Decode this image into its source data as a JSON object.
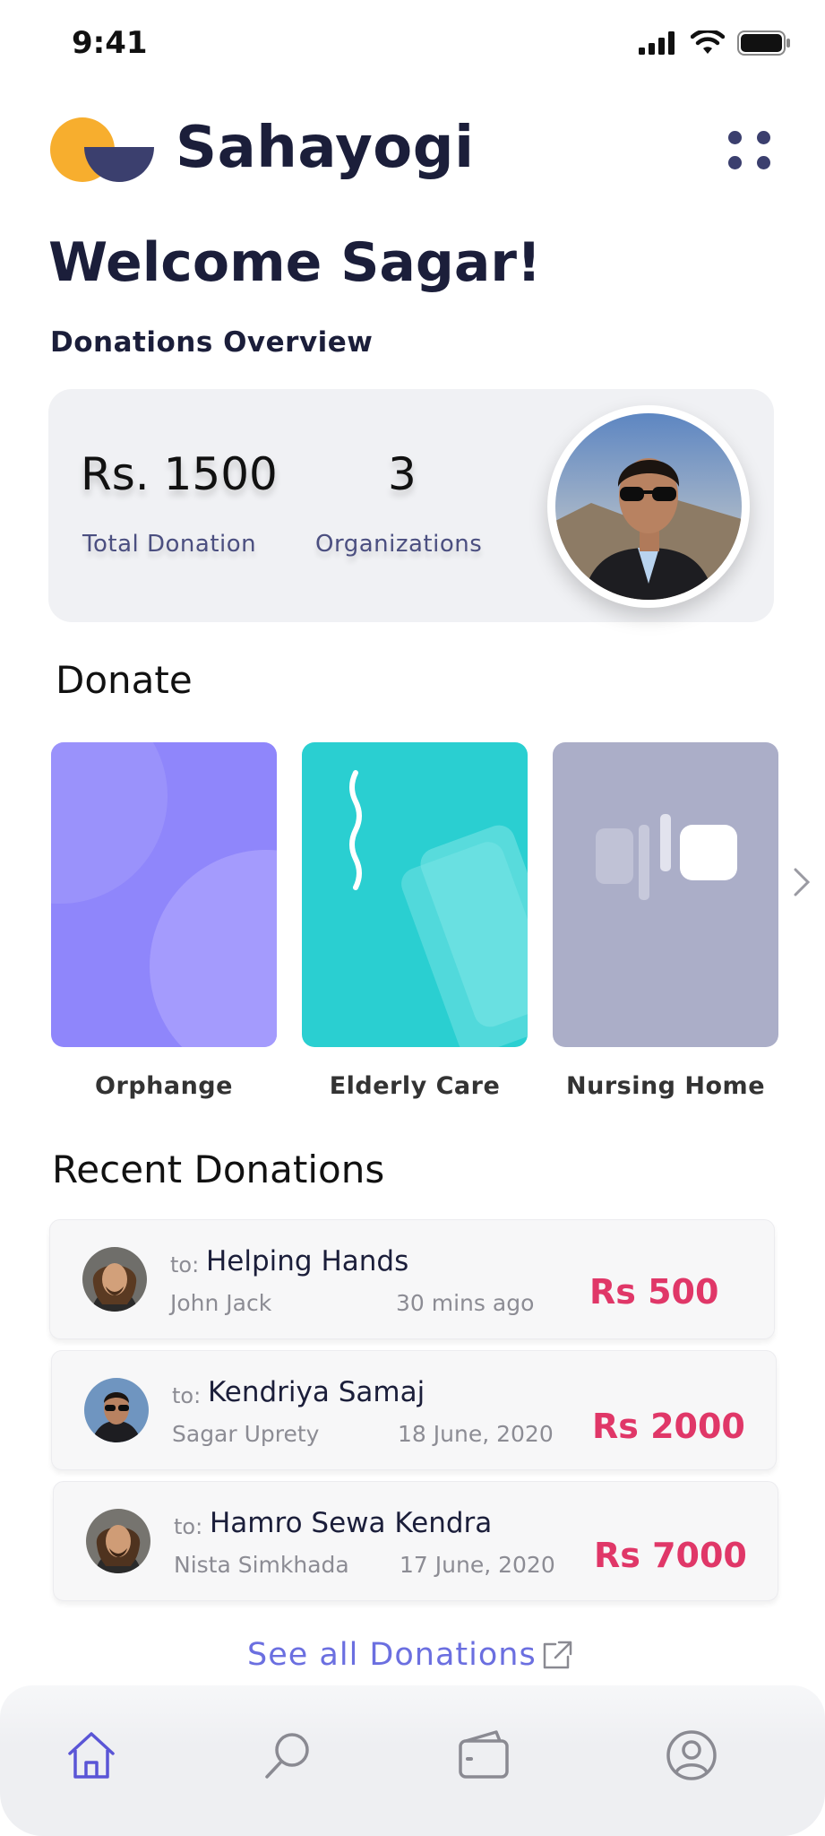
{
  "status_bar": {
    "time": "9:41"
  },
  "app": {
    "name": "Sahayogi"
  },
  "header": {
    "welcome": "Welcome Sagar!",
    "overview_label": "Donations Overview"
  },
  "overview": {
    "total_donation_value": "Rs. 1500",
    "total_donation_label": "Total Donation",
    "organizations_value": "3",
    "organizations_label": "Organizations"
  },
  "donate": {
    "heading": "Donate",
    "categories": [
      {
        "label": "Orphange",
        "color": "#8f86fb"
      },
      {
        "label": "Elderly Care",
        "color": "#2acfd1"
      },
      {
        "label": "Nursing Home",
        "color": "#abaec8"
      }
    ]
  },
  "recent": {
    "heading": "Recent Donations",
    "to_prefix": "to:",
    "items": [
      {
        "org": "Helping Hands",
        "donor": "John Jack",
        "time": "30 mins ago",
        "amount": "Rs 500"
      },
      {
        "org": "Kendriya Samaj",
        "donor": "Sagar Uprety",
        "time": "18 June, 2020",
        "amount": "Rs 2000"
      },
      {
        "org": "Hamro Sewa Kendra",
        "donor": "Nista Simkhada",
        "time": "17 June, 2020",
        "amount": "Rs 7000"
      }
    ],
    "see_all": "See all Donations"
  },
  "nav": {
    "icons": [
      "home-icon",
      "search-icon",
      "wallet-icon",
      "profile-icon"
    ],
    "active": "home-icon"
  },
  "colors": {
    "accent": "#6b6fe0",
    "amount": "#e03768",
    "brand_dark": "#3b3f6e",
    "brand_yellow": "#f7ae2e"
  }
}
